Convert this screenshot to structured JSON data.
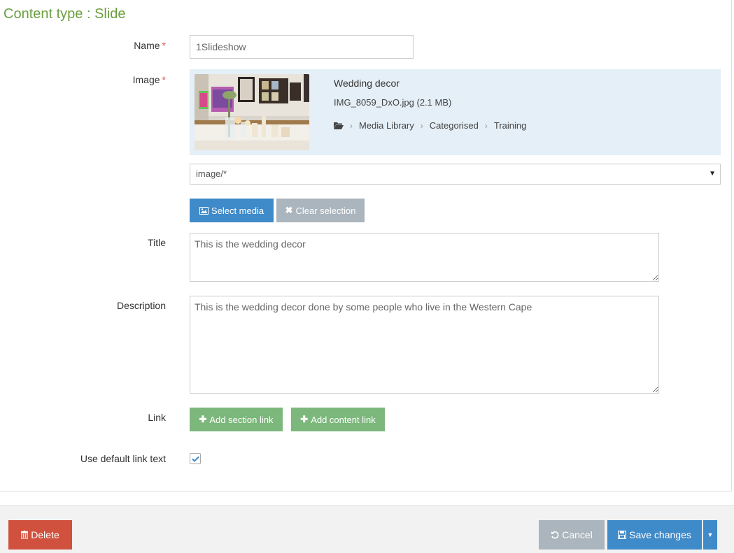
{
  "page": {
    "title": "Content type : Slide"
  },
  "form": {
    "name": {
      "label": "Name",
      "required_mark": "*",
      "value": "1Slideshow"
    },
    "image": {
      "label": "Image",
      "required_mark": "*",
      "media_name": "Wedding decor",
      "media_file": "IMG_8059_DxO.jpg (2.1 MB)",
      "path": [
        "Media Library",
        "Categorised",
        "Training"
      ],
      "filter": "image/*",
      "select_media_label": "Select media",
      "clear_selection_label": "Clear selection"
    },
    "title": {
      "label": "Title",
      "value": "This is the wedding decor"
    },
    "description": {
      "label": "Description",
      "value": "This is the wedding decor done by some people who live in the Western Cape"
    },
    "link": {
      "label": "Link",
      "add_section_label": "Add section link",
      "add_content_label": "Add content link"
    },
    "default_link_text": {
      "label": "Use default link text",
      "checked": true
    }
  },
  "footer": {
    "delete_label": "Delete",
    "cancel_label": "Cancel",
    "save_label": "Save changes"
  },
  "colors": {
    "title_green": "#6a9f3f",
    "primary_blue": "#3f8ac9",
    "danger_red": "#d0523e",
    "success_green": "#7cb77c",
    "muted_grey": "#aab5bd",
    "media_bg": "#e5eff7"
  },
  "icons": [
    "folder-open-icon",
    "picture-icon",
    "times-icon",
    "plus-icon",
    "check-icon",
    "trash-icon",
    "undo-icon",
    "floppy-icon",
    "caret-down-icon",
    "chevron-right-icon"
  ]
}
